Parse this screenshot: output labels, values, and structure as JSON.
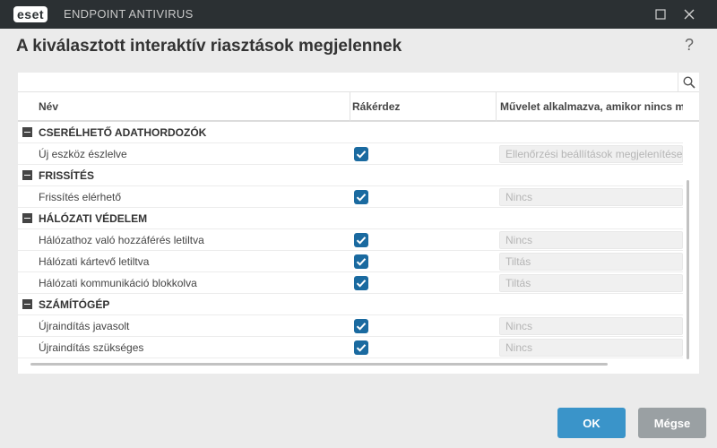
{
  "titlebar": {
    "logo": "eset",
    "app_name": "ENDPOINT ANTIVIRUS",
    "maximize_icon": "maximize-icon",
    "close_icon": "close-icon"
  },
  "dialog": {
    "title": "A kiválasztott interaktív riasztások megjelennek",
    "help": "?"
  },
  "table": {
    "search_icon": "search-icon",
    "columns": [
      "Név",
      "Rákérdez",
      "Művelet alkalmazva, amikor nincs m"
    ],
    "groups": [
      {
        "name": "CSERÉLHETŐ ADATHORDOZÓK",
        "items": [
          {
            "label": "Új eszköz észlelve",
            "checked": true,
            "action": "Ellenőrzési beállítások megjelenítése"
          }
        ]
      },
      {
        "name": "FRISSÍTÉS",
        "items": [
          {
            "label": "Frissítés elérhető",
            "checked": true,
            "action": "Nincs"
          }
        ]
      },
      {
        "name": "HÁLÓZATI VÉDELEM",
        "items": [
          {
            "label": "Hálózathoz való hozzáférés letiltva",
            "checked": true,
            "action": "Nincs"
          },
          {
            "label": "Hálózati kártevő letiltva",
            "checked": true,
            "action": "Tiltás"
          },
          {
            "label": "Hálózati kommunikáció blokkolva",
            "checked": true,
            "action": "Tiltás"
          }
        ]
      },
      {
        "name": "SZÁMÍTÓGÉP",
        "items": [
          {
            "label": "Újraindítás javasolt",
            "checked": true,
            "action": "Nincs"
          },
          {
            "label": "Újraindítás szükséges",
            "checked": true,
            "action": "Nincs"
          }
        ]
      }
    ]
  },
  "buttons": {
    "ok": "OK",
    "cancel": "Mégse"
  },
  "colors": {
    "titlebar": "#2b3033",
    "checkbox": "#1a6aa0",
    "ok_button": "#3a94c9",
    "cancel_button": "#9aa0a3"
  }
}
